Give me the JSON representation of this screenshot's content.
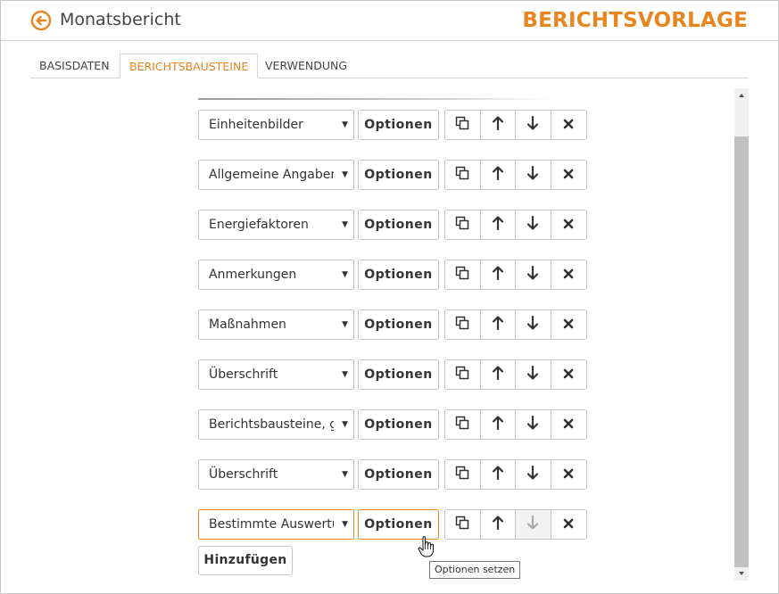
{
  "header": {
    "title": "Monatsbericht",
    "brand": "BERICHTSVORLAGE"
  },
  "tabs": [
    {
      "label": "BASISDATEN",
      "active": false
    },
    {
      "label": "BERICHTSBAUSTEINE",
      "active": true
    },
    {
      "label": "VERWENDUNG",
      "active": false
    }
  ],
  "rows": [
    {
      "value": "Einheitenbilder",
      "options_label": "Optionen"
    },
    {
      "value": "Allgemeine Angaben",
      "options_label": "Optionen"
    },
    {
      "value": "Energiefaktoren",
      "options_label": "Optionen"
    },
    {
      "value": "Anmerkungen",
      "options_label": "Optionen"
    },
    {
      "value": "Maßnahmen",
      "options_label": "Optionen"
    },
    {
      "value": "Überschrift",
      "options_label": "Optionen"
    },
    {
      "value": "Berichtsbausteine, gruppiert",
      "options_label": "Optionen"
    },
    {
      "value": "Überschrift",
      "options_label": "Optionen"
    },
    {
      "value": "Bestimmte Auswertung",
      "options_label": "Optionen",
      "focused": true,
      "down_disabled": true
    }
  ],
  "add_button": "Hinzufügen",
  "tooltip": "Optionen setzen",
  "icons": {
    "back": "arrow-left-circle-icon",
    "copy": "copy-icon",
    "up": "arrow-up-icon",
    "down": "arrow-down-icon",
    "remove": "close-icon",
    "dropdown": "caret-down-icon"
  },
  "colors": {
    "accent": "#e8851e",
    "text": "#333333",
    "border": "#c6c6c6"
  }
}
